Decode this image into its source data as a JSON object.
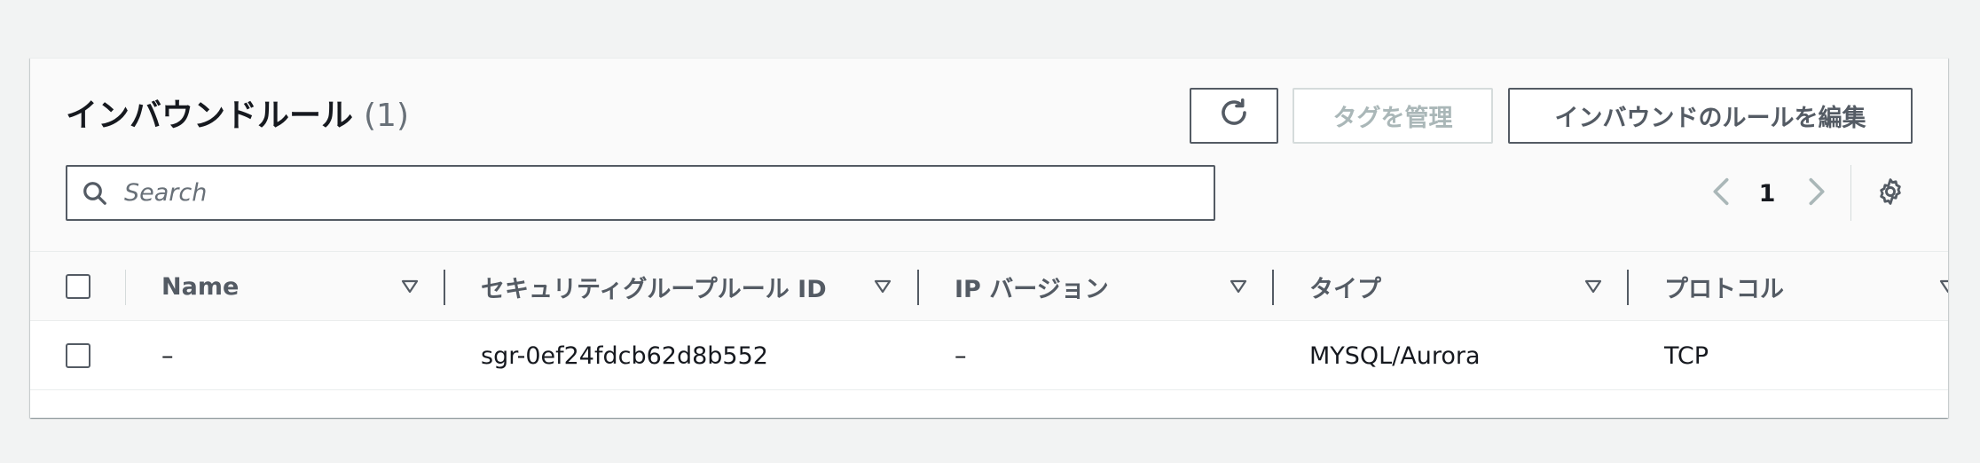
{
  "panel": {
    "title": "インバウンドルール",
    "count": "(1)"
  },
  "actions": {
    "refresh_icon": "refresh-icon",
    "manage_tags_label": "タグを管理",
    "edit_inbound_label": "インバウンドのルールを編集"
  },
  "search": {
    "placeholder": "Search",
    "value": ""
  },
  "pagination": {
    "current_page": "1"
  },
  "table": {
    "columns": [
      {
        "label": "Name"
      },
      {
        "label": "セキュリティグループルール ID"
      },
      {
        "label": "IP バージョン"
      },
      {
        "label": "タイプ"
      },
      {
        "label": "プロトコル"
      }
    ],
    "rows": [
      {
        "name": "–",
        "rule_id": "sgr-0ef24fdcb62d8b552",
        "ip_version": "–",
        "type": "MYSQL/Aurora",
        "protocol": "TCP"
      }
    ]
  },
  "colors": {
    "border_dark": "#545b64",
    "disabled": "#aab7b8",
    "text": "#16191f",
    "muted": "#687078"
  }
}
